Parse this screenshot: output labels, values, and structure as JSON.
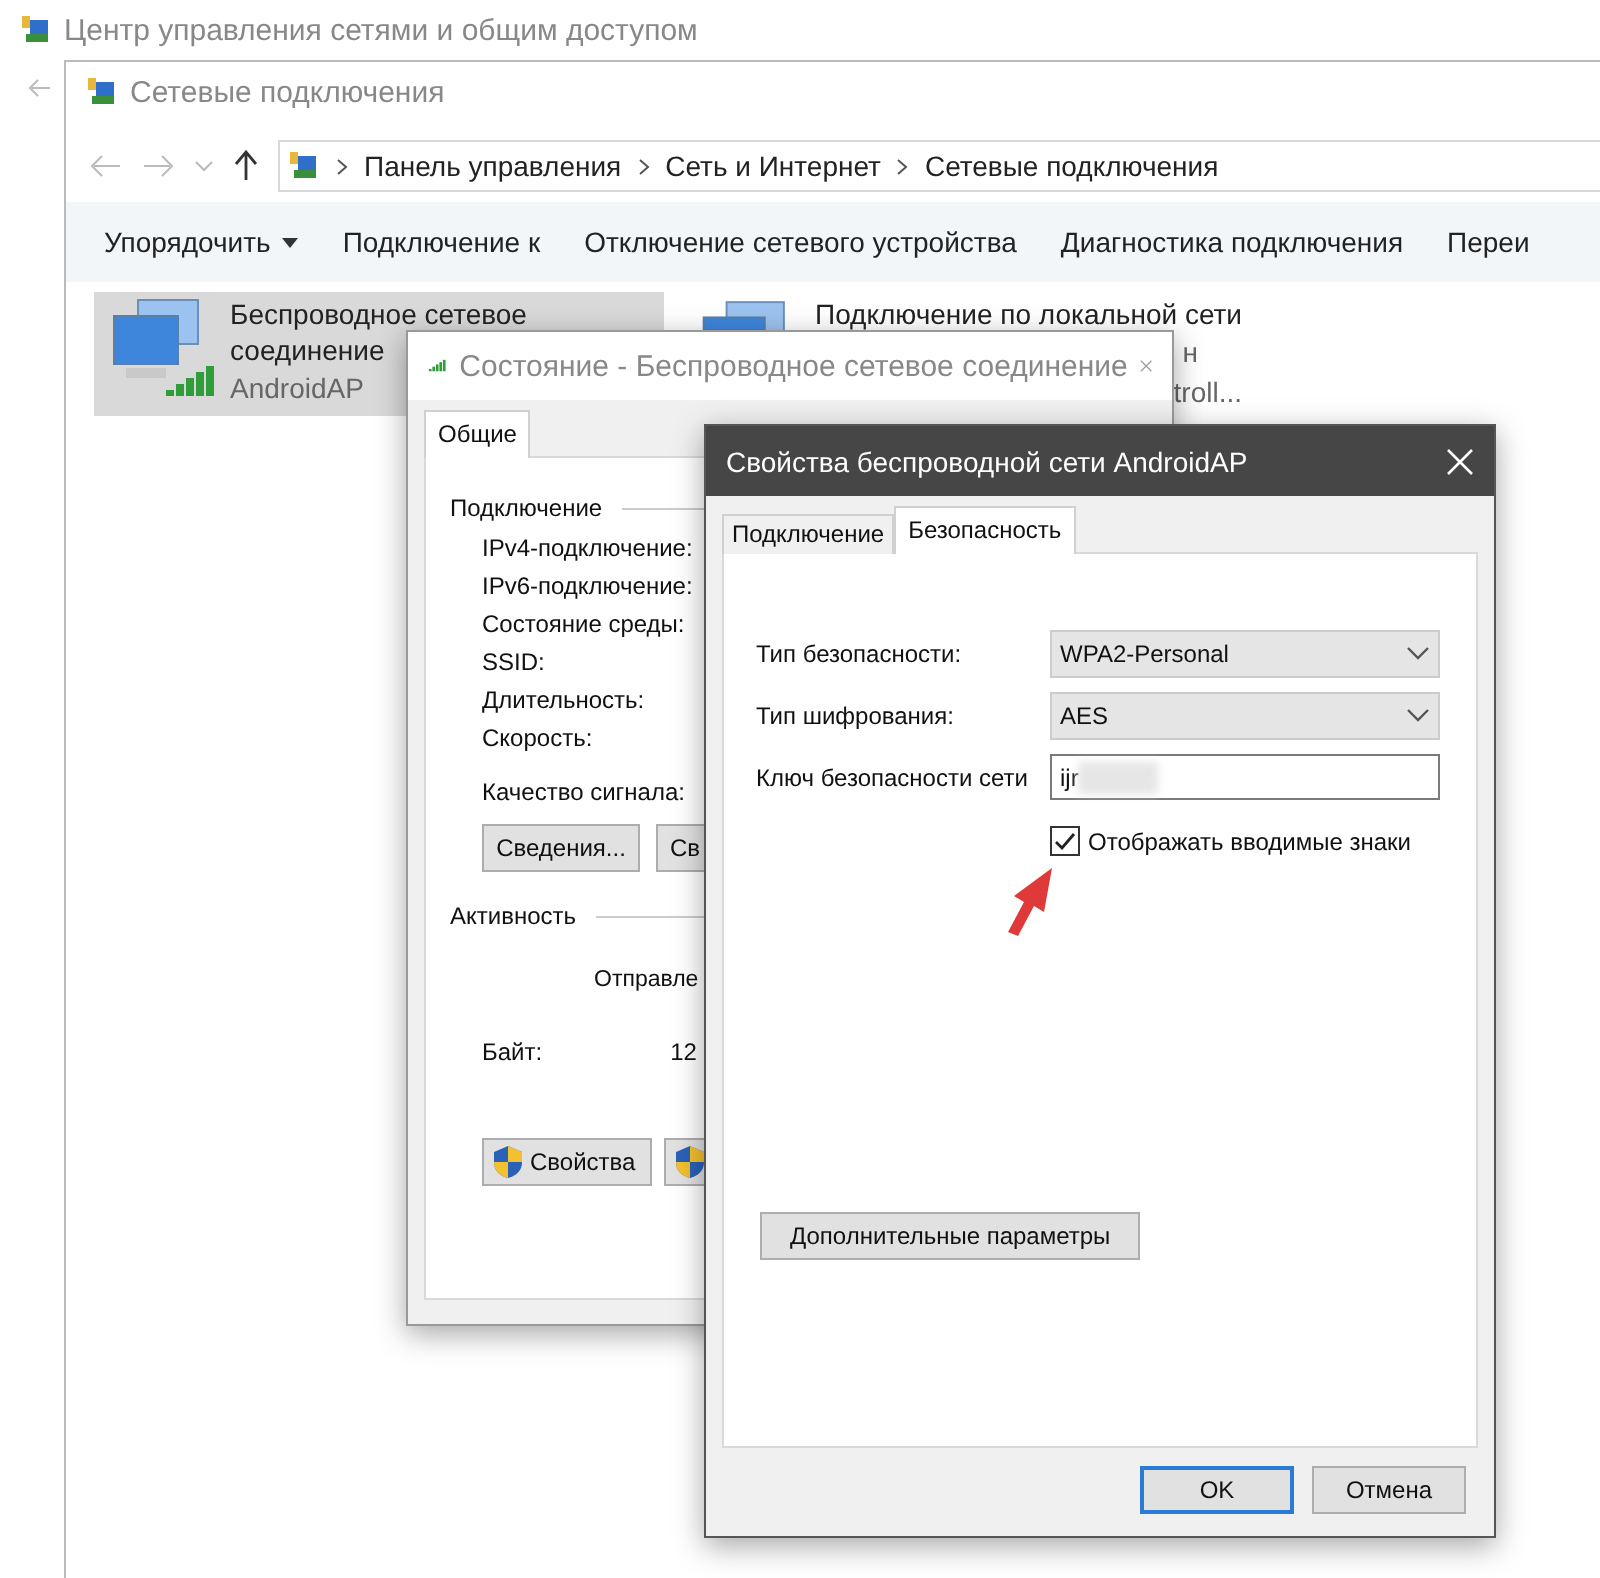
{
  "background_window": {
    "title": "Центр управления сетями и общим доступом"
  },
  "explorer": {
    "title": "Сетевые подключения",
    "breadcrumb": [
      "Панель управления",
      "Сеть и Интернет",
      "Сетевые подключения"
    ],
    "toolbar": [
      {
        "label": "Упорядочить",
        "dropdown": true
      },
      {
        "label": "Подключение к",
        "dropdown": false
      },
      {
        "label": "Отключение сетевого устройства",
        "dropdown": false
      },
      {
        "label": "Диагностика подключения",
        "dropdown": false
      },
      {
        "label": "Переи",
        "dropdown": false
      }
    ],
    "connections": [
      {
        "name_lines": [
          "Беспроводное сетевое",
          "соединение"
        ],
        "details": [
          "AndroidAP"
        ],
        "selected": true,
        "kind": "wireless"
      },
      {
        "name_lines": [
          "Подключение по локальной сети"
        ],
        "details": [
          "н",
          "troll..."
        ],
        "selected": false,
        "kind": "wired"
      }
    ]
  },
  "status_window": {
    "title": "Состояние - Беспроводное сетевое соединение",
    "tabs": [
      {
        "label": "Общие",
        "selected": true
      }
    ],
    "connection_group": "Подключение",
    "fields": [
      "IPv4-подключение:",
      "IPv6-подключение:",
      "Состояние среды:",
      "SSID:",
      "Длительность:",
      "Скорость:"
    ],
    "signal_label": "Качество сигнала:",
    "buttons": [
      {
        "label": "Сведения...",
        "shield": false
      },
      {
        "label": "Св",
        "shield": false
      }
    ],
    "activity_group": "Активность",
    "sent_header": "Отправле",
    "bytes_label": "Байт:",
    "bytes_sent": "12",
    "bottom_buttons": [
      {
        "label": "Свойства",
        "shield": true
      },
      {
        "shield": true
      }
    ]
  },
  "properties_dialog": {
    "title": "Свойства беспроводной сети AndroidAP",
    "tabs": [
      {
        "label": "Подключение",
        "selected": false
      },
      {
        "label": "Безопасность",
        "selected": true
      }
    ],
    "fields": [
      {
        "kind": "select",
        "label": "Тип безопасности:",
        "value": "WPA2-Personal"
      },
      {
        "kind": "select",
        "label": "Тип шифрования:",
        "value": "AES"
      },
      {
        "kind": "text",
        "label": "Ключ безопасности сети",
        "value": "ijr"
      }
    ],
    "show_characters": {
      "label": "Отображать вводимые знаки",
      "checked": true
    },
    "advanced_button": "Дополнительные параметры",
    "buttons": [
      {
        "label": "OK",
        "default": true
      },
      {
        "label": "Отмена",
        "default": false
      }
    ]
  }
}
